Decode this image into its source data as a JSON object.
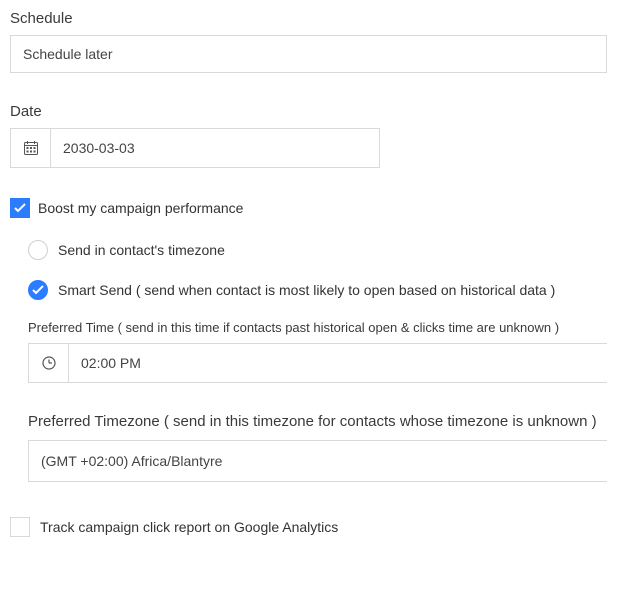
{
  "schedule": {
    "label": "Schedule",
    "value": "Schedule later"
  },
  "date": {
    "label": "Date",
    "value": "2030-03-03"
  },
  "boost": {
    "label": "Boost my campaign performance",
    "checked": true,
    "options": {
      "contact_tz": {
        "label": "Send in contact's timezone",
        "selected": false
      },
      "smart_send": {
        "label": "Smart Send ( send when contact is most likely to open based on historical data )",
        "selected": true
      }
    }
  },
  "preferred_time": {
    "label": "Preferred Time ( send in this time if contacts past historical open & clicks time are unknown )",
    "value": "02:00 PM"
  },
  "preferred_tz": {
    "label": "Preferred Timezone ( send in this timezone for contacts whose timezone is unknown )",
    "value": "(GMT +02:00) Africa/Blantyre"
  },
  "ga_track": {
    "label": "Track campaign click report on Google Analytics",
    "checked": false
  }
}
